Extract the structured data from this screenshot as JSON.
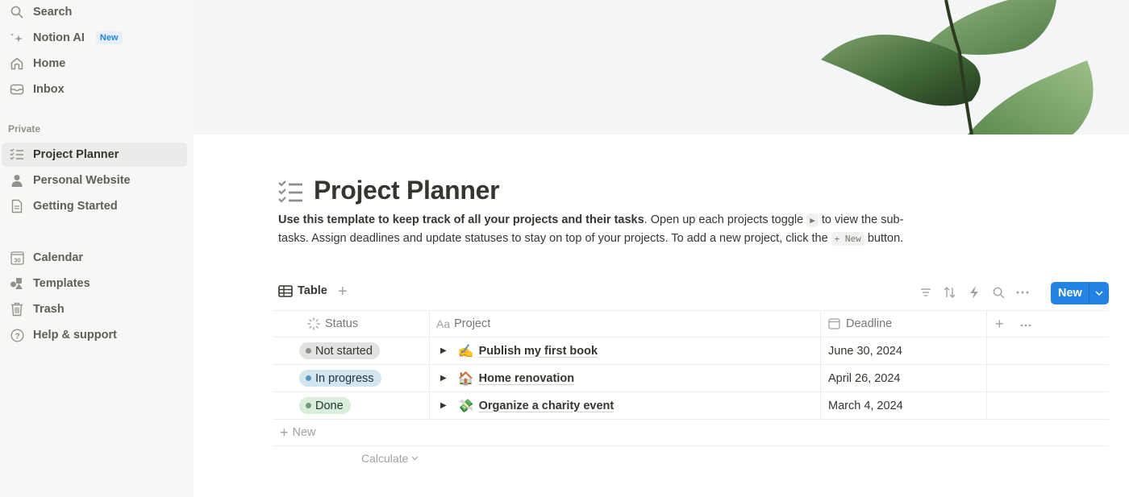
{
  "sidebar": {
    "top_items": [
      {
        "label": "Search",
        "icon": "search-icon"
      },
      {
        "label": "Notion AI",
        "icon": "sparkle-icon",
        "badge": "New"
      },
      {
        "label": "Home",
        "icon": "home-icon"
      },
      {
        "label": "Inbox",
        "icon": "inbox-icon"
      }
    ],
    "section_label": "Private",
    "private_items": [
      {
        "label": "Project Planner",
        "icon": "checklist-icon",
        "active": true
      },
      {
        "label": "Personal Website",
        "icon": "person-icon"
      },
      {
        "label": "Getting Started",
        "icon": "document-icon"
      }
    ],
    "bottom_items": [
      {
        "label": "Calendar",
        "icon": "calendar-icon",
        "icon_text": "30"
      },
      {
        "label": "Templates",
        "icon": "templates-icon"
      },
      {
        "label": "Trash",
        "icon": "trash-icon"
      },
      {
        "label": "Help & support",
        "icon": "help-icon"
      }
    ]
  },
  "page": {
    "title": "Project Planner",
    "icon": "checklist-icon",
    "description": {
      "bold": "Use this template to keep track of all your projects and their tasks",
      "part1": ". Open up each projects toggle ",
      "toggle_code": "▶",
      "part2": " to view the sub-tasks. Assign deadlines and update statuses to stay on top of your projects. To add a new project, click the ",
      "new_code": "+ New",
      "part3": " button."
    }
  },
  "view": {
    "tab_label": "Table",
    "add_view": "+",
    "tools": [
      "filter-icon",
      "sort-icon",
      "automation-icon",
      "search-icon",
      "more-icon"
    ],
    "new_button": "New"
  },
  "table": {
    "columns": [
      {
        "label": "Status",
        "icon": "status-icon"
      },
      {
        "label": "Project",
        "icon_text": "Aa"
      },
      {
        "label": "Deadline",
        "icon": "calendar-icon"
      }
    ],
    "rows": [
      {
        "status": "Not started",
        "status_bg": "#e3e2e0",
        "status_dot": "#91918e",
        "status_color": "#37352f",
        "emoji": "✍️",
        "project": "Publish my first book",
        "deadline": "June 30, 2024"
      },
      {
        "status": "In progress",
        "status_bg": "#d3e5ef",
        "status_dot": "#5b97bd",
        "status_color": "#183347",
        "emoji": "🏠",
        "project": "Home renovation",
        "deadline": "April 26, 2024"
      },
      {
        "status": "Done",
        "status_bg": "#dbeddb",
        "status_dot": "#6c9b7d",
        "status_color": "#1c3829",
        "emoji": "💸",
        "project": "Organize a charity event",
        "deadline": "March 4, 2024"
      }
    ],
    "new_row_label": "New",
    "calculate_label": "Calculate"
  },
  "colors": {
    "accent": "#2383e2",
    "sidebar_bg": "#f7f7f5",
    "text": "#37352f"
  }
}
